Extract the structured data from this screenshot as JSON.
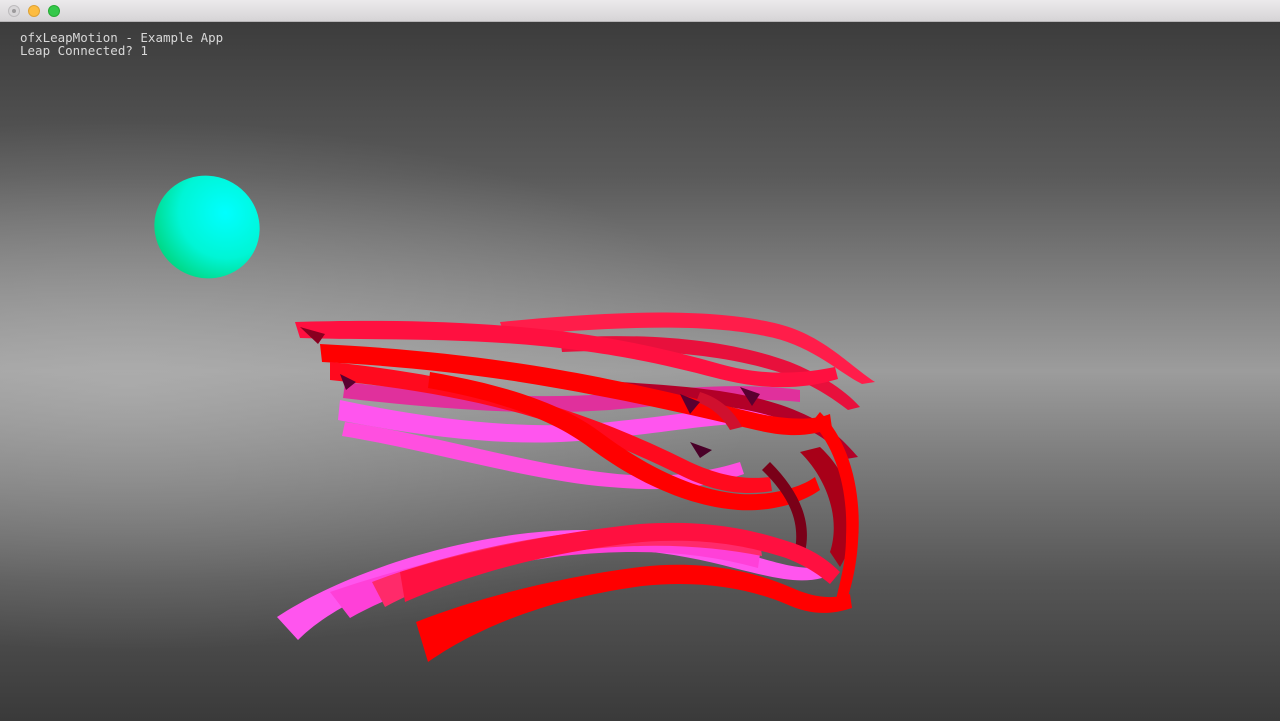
{
  "app": {
    "title": "ofxLeapMotion - Example App",
    "status_label": "Leap Connected? 1"
  },
  "colors": {
    "sphere_light": "#00ffee",
    "sphere_dark": "#00d98a",
    "ribbon_red": "#ff0000",
    "ribbon_crimson": "#ff1744",
    "ribbon_pink": "#ff3fb0",
    "ribbon_magenta": "#ff55ee",
    "ribbon_shadow": "#8a0020"
  },
  "icons": {
    "close": "close-icon",
    "minimize": "minimize-icon",
    "zoom": "zoom-icon"
  }
}
